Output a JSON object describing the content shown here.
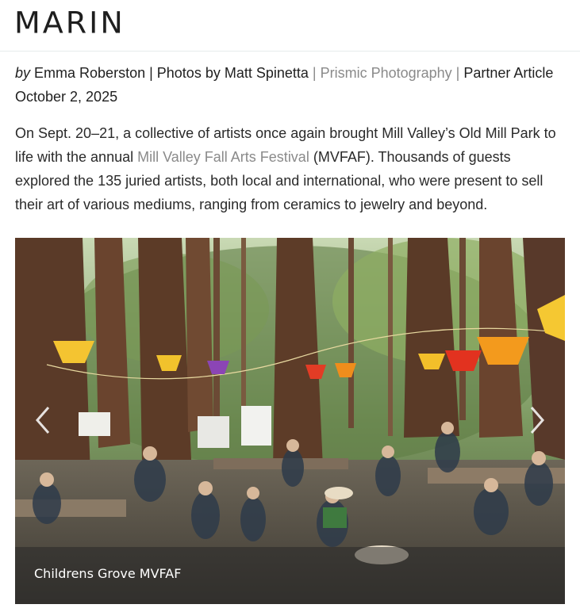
{
  "site": {
    "logo": "MARIN"
  },
  "byline": {
    "by": "by",
    "author": "Emma Roberston",
    "sep1": " | ",
    "photos": "Photos by Matt Spinetta",
    "sep2": " | ",
    "studio": "Prismic Photography",
    "sep3": " | ",
    "type": "Partner Article",
    "date": "October 2, 2025"
  },
  "intro": {
    "part1": "On Sept. 20–21, a collective of artists once again brought Mill Valley’s Old Mill Park to life with the annual ",
    "link": "Mill Valley Fall Arts Festival",
    "part2": " (MVFAF). Thousands of guests explored the 135 juried artists, both local and international, who were present to sell their art of various mediums, ranging from ceramics to jewelry and beyond."
  },
  "slideshow": {
    "caption": "Childrens Grove MVFAF",
    "prev_icon": "chevron-left-icon",
    "next_icon": "chevron-right-icon"
  }
}
